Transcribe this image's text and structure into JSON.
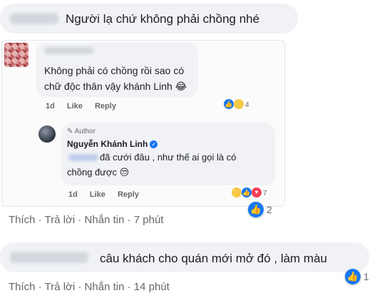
{
  "comment1": {
    "text": "Người lạ chứ không phải chồng nhé"
  },
  "embedded": {
    "reply1": {
      "text": "Không phải có chồng rồi sao có chữ độc thân vậy khánh Linh 😂",
      "time": "1d",
      "like": "Like",
      "reply": "Reply",
      "reaction_count": "4"
    },
    "reply2": {
      "author_tag": "Author",
      "author_name": "Nguyễn Khánh Linh",
      "text": "đã cưới đâu , như thế ai gọi là có chồng được 😒",
      "time": "1d",
      "like": "Like",
      "reply": "Reply",
      "reaction_count": "7"
    }
  },
  "comment1_meta": {
    "like": "Thích",
    "reply": "Trả lời",
    "message": "Nhắn tin",
    "time": "7 phút",
    "reaction_count": "2"
  },
  "comment2": {
    "text": "câu khách cho quán mới mở đó , làm màu"
  },
  "comment2_meta": {
    "like": "Thích",
    "reply": "Trả lời",
    "message": "Nhắn tin",
    "time": "14 phút",
    "reaction_count": "1"
  },
  "colors": {
    "bubble": "#f0f2f5",
    "meta_text": "#65676b",
    "like_blue": "#1877f2"
  }
}
